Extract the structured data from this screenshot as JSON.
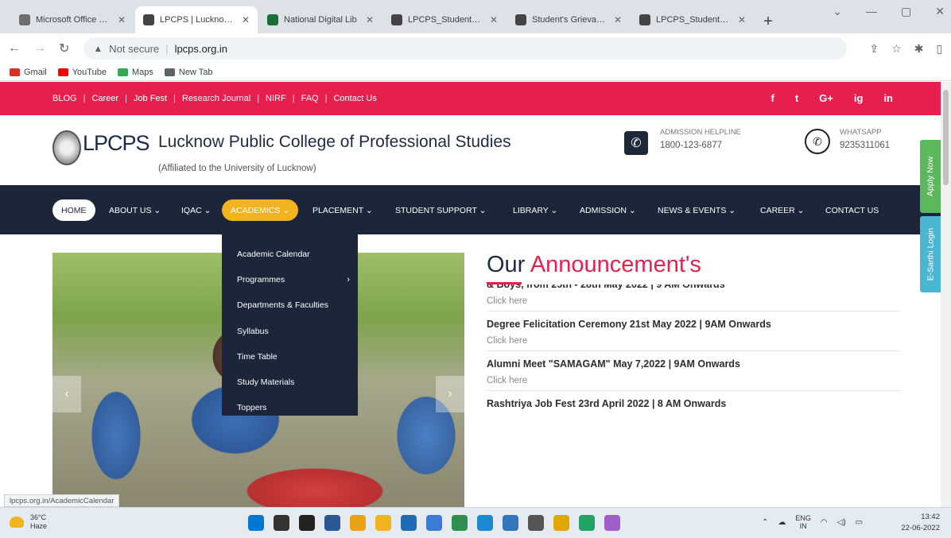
{
  "browser": {
    "tabs": [
      {
        "title": "Microsoft Office Ess",
        "color": "#6d6d6d",
        "active": false
      },
      {
        "title": "LPCPS | Lucknow P...",
        "color": "#444444",
        "active": true
      },
      {
        "title": "National Digital Lib",
        "color": "#1a6e3a",
        "active": false
      },
      {
        "title": "LPCPS_Students_Fe",
        "color": "#444444",
        "active": false
      },
      {
        "title": "Student's Grievance",
        "color": "#444444",
        "active": false
      },
      {
        "title": "LPCPS_Students_Fe",
        "color": "#444444",
        "active": false
      }
    ],
    "new_tab": "+",
    "address": {
      "warning": "Not secure",
      "url": "lpcps.org.in"
    },
    "bookmarks": [
      {
        "label": "Gmail",
        "color": "#d93025"
      },
      {
        "label": "YouTube",
        "color": "#ff0000"
      },
      {
        "label": "Maps",
        "color": "#34a853"
      },
      {
        "label": "New Tab",
        "color": "#5f6368"
      }
    ],
    "status_url": "lpcps.org.in/AcademicCalendar"
  },
  "site": {
    "top_links": [
      "BLOG",
      "Career",
      "Job Fest",
      "Research Journal",
      "NIRF",
      "FAQ",
      "Contact Us"
    ],
    "social": [
      "f",
      "t",
      "G+",
      "ig",
      "in"
    ],
    "logo_text": "LPCPS",
    "college_name": "Lucknow Public College of Professional Studies",
    "affiliation": "(Affiliated to the University of Lucknow)",
    "helpline": {
      "label": "ADMISSION HELPLINE",
      "number": "1800-123-6877"
    },
    "whatsapp": {
      "label": "WHATSAPP",
      "number": "9235311061"
    },
    "nav": [
      {
        "label": "HOME"
      },
      {
        "label": "ABOUT US ⌄"
      },
      {
        "label": "IQAC ⌄"
      },
      {
        "label": "ACADEMICS ⌄"
      },
      {
        "label": "PLACEMENT ⌄"
      },
      {
        "label": "STUDENT SUPPORT ⌄"
      },
      {
        "label": "LIBRARY ⌄"
      },
      {
        "label": "ADMISSION ⌄"
      },
      {
        "label": "NEWS & EVENTS ⌄"
      },
      {
        "label": "CAREER ⌄"
      },
      {
        "label": "CONTACT US"
      }
    ],
    "dropdown": [
      "Academic Calendar",
      "Programmes",
      "Departments & Faculties",
      "Syllabus",
      "Time Table",
      "Study Materials",
      "Toppers"
    ],
    "announcements": {
      "title_part1": "Our ",
      "title_part2": "Announcement's",
      "items": [
        {
          "title": "& Boys, from 25th - 28th May 2022 | 9 AM Onwards",
          "link": "Click here"
        },
        {
          "title": "Degree Felicitation Ceremony 21st May 2022 | 9AM Onwards",
          "link": "Click here"
        },
        {
          "title": "Alumni Meet \"SAMAGAM\" May 7,2022 | 9AM Onwards",
          "link": "Click here"
        },
        {
          "title": "Rashtriya Job Fest 23rd April 2022 | 8 AM Onwards",
          "link": ""
        }
      ]
    },
    "side_buttons": {
      "apply": "Apply Now",
      "esarthi": "E-Sarthi Login"
    }
  },
  "taskbar": {
    "weather": {
      "temp": "36°C",
      "condition": "Haze"
    },
    "lang": {
      "line1": "ENG",
      "line2": "IN"
    },
    "time": "13:42",
    "date": "22-06-2022",
    "apps_colors": [
      "#0078d4",
      "#333333",
      "#222222",
      "#2b5797",
      "#e8a317",
      "#f2b41e",
      "#1e6bb8",
      "#3a7bd5",
      "#2f8f4e",
      "#1b8ad3",
      "#3277bc",
      "#555555",
      "#e0a800",
      "#21a366",
      "#a05fc8"
    ]
  }
}
